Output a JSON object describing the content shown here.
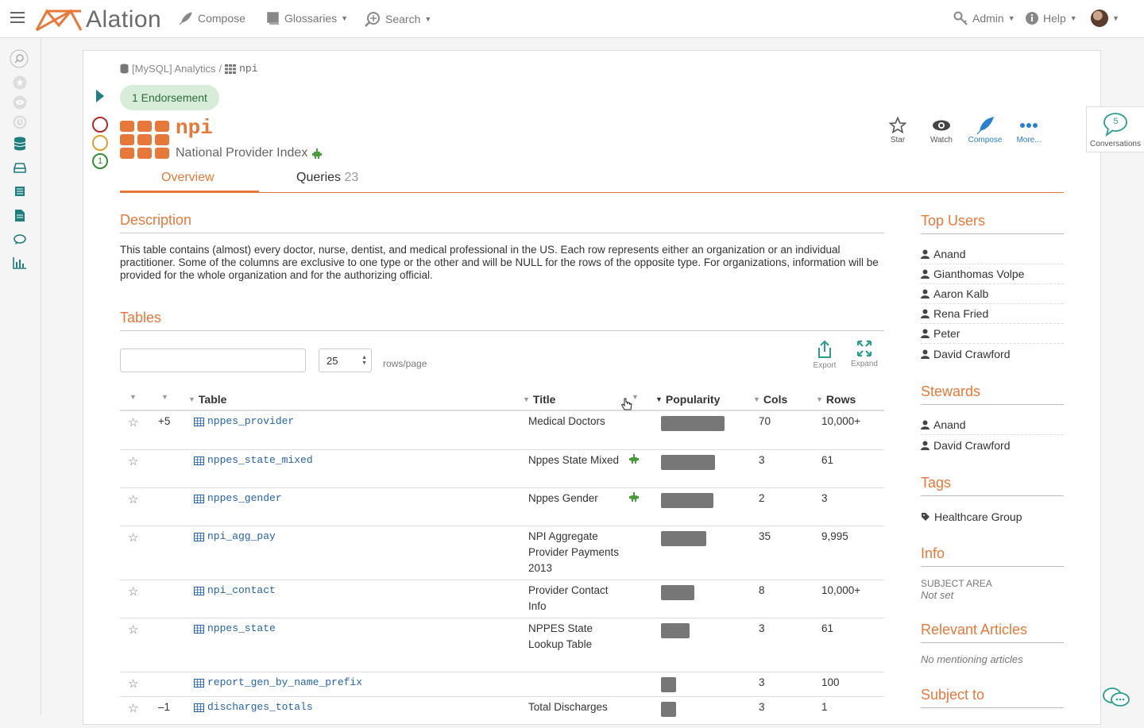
{
  "app": {
    "name": "Alation"
  },
  "nav": {
    "compose": "Compose",
    "glossaries": "Glossaries",
    "search": "Search",
    "admin": "Admin",
    "help": "Help"
  },
  "breadcrumb": {
    "source": "[MySQL] Analytics",
    "separator": "/",
    "table": "npi"
  },
  "endorsement": "1 Endorsement",
  "trust": {
    "count": "1"
  },
  "object": {
    "title": "npi",
    "subtitle": "National Provider Index"
  },
  "actions": {
    "star": "Star",
    "watch": "Watch",
    "compose": "Compose",
    "more": "More..."
  },
  "conversations": {
    "count": "5",
    "label": "Conversations"
  },
  "tabs": [
    {
      "label": "Overview"
    },
    {
      "label": "Queries",
      "count": "23"
    }
  ],
  "description": {
    "heading": "Description",
    "text": "This table contains (almost) every doctor, nurse, dentist, and medical professional in the US. Each row represents either an organization or an individual practitioner. Some of the columns are exclusive to one type or the other and will be NULL for the rows of the opposite type. For organizations, information will be provided for the whole organization and for the authorizing official."
  },
  "tables_section": {
    "heading": "Tables",
    "rows_per_page": "25",
    "rows_label": "rows/page",
    "export": "Export",
    "expand": "Expand",
    "columns": [
      "Table",
      "Title",
      "Popularity",
      "Cols",
      "Rows"
    ],
    "rows": [
      {
        "vote": "+5",
        "name": "nppes_provider",
        "title": "Medical Doctors",
        "popularity": 0.85,
        "cols": "70",
        "rows": "10,000+",
        "flag": false
      },
      {
        "vote": "",
        "name": "nppes_state_mixed",
        "title": "Nppes State Mixed",
        "popularity": 0.72,
        "cols": "3",
        "rows": "61",
        "flag": true
      },
      {
        "vote": "",
        "name": "nppes_gender",
        "title": "Nppes Gender",
        "popularity": 0.7,
        "cols": "2",
        "rows": "3",
        "flag": true
      },
      {
        "vote": "",
        "name": "npi_agg_pay",
        "title": "NPI Aggregate Provider Payments 2013",
        "popularity": 0.61,
        "cols": "35",
        "rows": "9,995",
        "flag": false
      },
      {
        "vote": "",
        "name": "npi_contact",
        "title": "Provider Contact Info",
        "popularity": 0.45,
        "cols": "8",
        "rows": "10,000+",
        "flag": false
      },
      {
        "vote": "",
        "name": "nppes_state",
        "title": "NPPES State Lookup Table",
        "popularity": 0.38,
        "cols": "3",
        "rows": "61",
        "flag": false
      },
      {
        "vote": "",
        "name": "report_gen_by_name_prefix",
        "title": "",
        "popularity": 0.2,
        "cols": "3",
        "rows": "100",
        "flag": false
      },
      {
        "vote": "–1",
        "name": "discharges_totals",
        "title": "Total Discharges",
        "popularity": 0.2,
        "cols": "3",
        "rows": "1",
        "flag": false
      }
    ]
  },
  "sidebar": {
    "top_users_heading": "Top Users",
    "top_users": [
      "Anand",
      "Gianthomas Volpe",
      "Aaron Kalb",
      "Rena Fried",
      "Peter",
      "David Crawford"
    ],
    "stewards_heading": "Stewards",
    "stewards": [
      "Anand",
      "David Crawford"
    ],
    "tags_heading": "Tags",
    "tags": [
      "Healthcare Group"
    ],
    "info_heading": "Info",
    "subject_area_label": "SUBJECT AREA",
    "subject_area_value": "Not set",
    "articles_heading": "Relevant Articles",
    "articles_value": "No mentioning articles",
    "subject_to_heading": "Subject to"
  },
  "colors": {
    "accent": "#e8783a",
    "link": "#2563a7",
    "teal": "#1e7f7f"
  }
}
